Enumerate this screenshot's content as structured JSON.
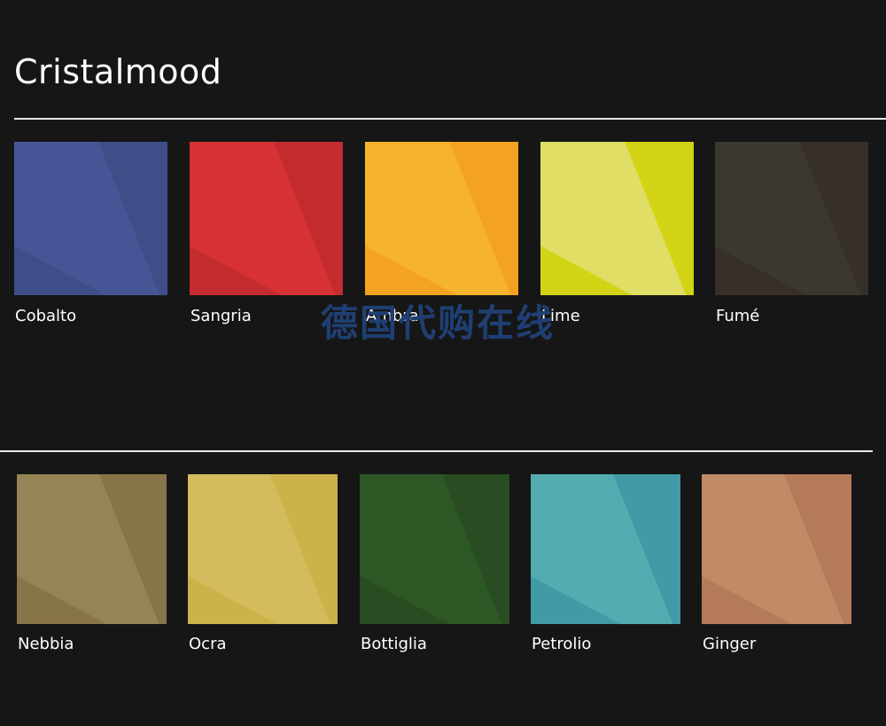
{
  "brand": {
    "title": "Cristalmood"
  },
  "watermark": {
    "text": "德国代购在线"
  },
  "rows": [
    {
      "swatches": [
        {
          "name": "Cobalto",
          "base": "#475596",
          "shade": "#3f4d88",
          "light": "#4a5a9e"
        },
        {
          "name": "Sangria",
          "base": "#d63236",
          "shade": "#c42b2e",
          "light": "#da3a3c"
        },
        {
          "name": "Ambra",
          "base": "#f6b32e",
          "shade": "#f3a321",
          "light": "#f8bd3c"
        },
        {
          "name": "Lime",
          "base": "#e0de64",
          "shade": "#d3d315",
          "light": "#e4e272"
        },
        {
          "name": "Fumé",
          "base": "#3d3731",
          "shade": "#362f2a",
          "light": "#423b35"
        }
      ]
    },
    {
      "swatches": [
        {
          "name": "Nebbia",
          "base": "#958456",
          "shade": "#887449",
          "light": "#9b8a5c"
        },
        {
          "name": "Ocra",
          "base": "#d4bc5e",
          "shade": "#cdb24a",
          "light": "#d8c266"
        },
        {
          "name": "Bottiglia",
          "base": "#2e5726",
          "shade": "#294c22",
          "light": "#325c2a"
        },
        {
          "name": "Petrolio",
          "base": "#53adb0",
          "shade": "#409ba6",
          "light": "#5ab3b5"
        },
        {
          "name": "Ginger",
          "base": "#c18b66",
          "shade": "#b47a5a",
          "light": "#c6926c"
        }
      ]
    }
  ]
}
